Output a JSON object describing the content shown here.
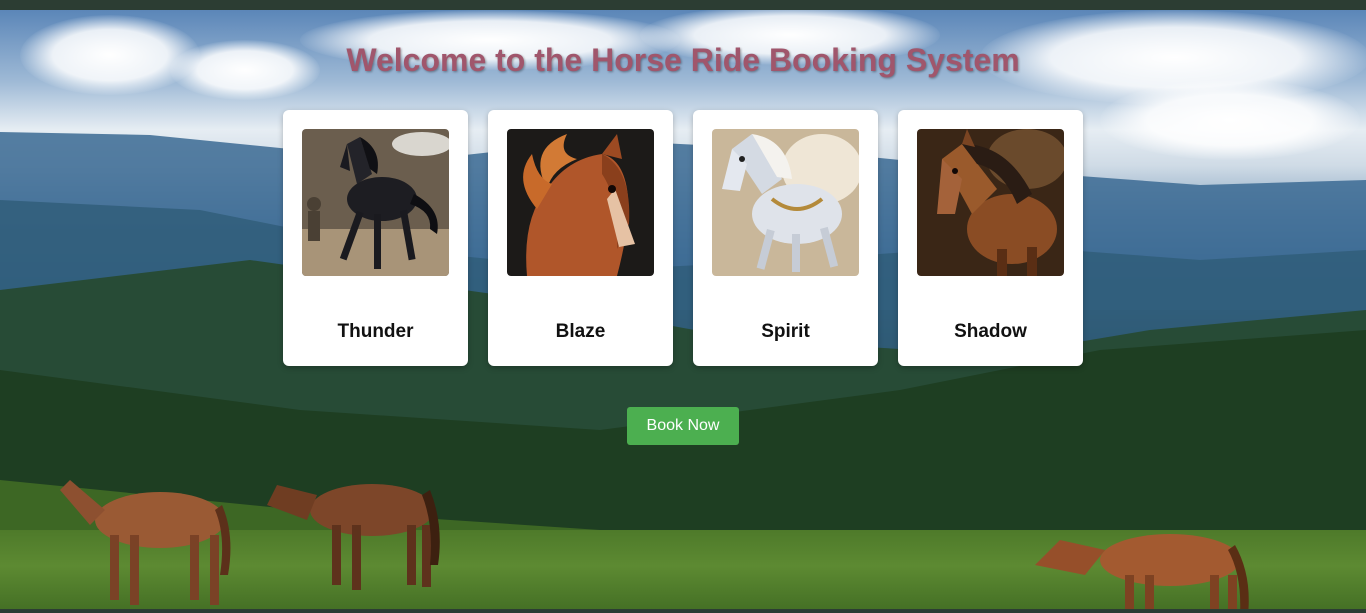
{
  "page": {
    "title": "Welcome to the Horse Ride Booking System"
  },
  "horses": [
    {
      "name": "Thunder",
      "image_icon": "black-horse-galloping-icon"
    },
    {
      "name": "Blaze",
      "image_icon": "chestnut-horse-fiery-mane-icon"
    },
    {
      "name": "Spirit",
      "image_icon": "white-horse-armored-icon"
    },
    {
      "name": "Shadow",
      "image_icon": "bay-horse-icon"
    }
  ],
  "actions": {
    "book_label": "Book Now"
  },
  "colors": {
    "title": "#a0566c",
    "button": "#4caf50",
    "card": "#ffffff"
  }
}
